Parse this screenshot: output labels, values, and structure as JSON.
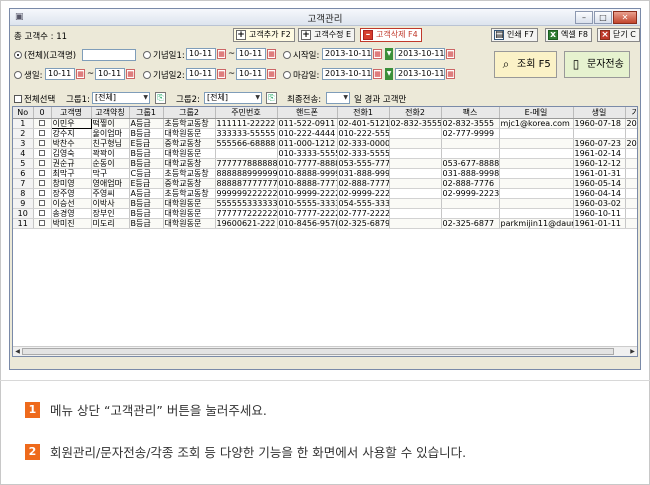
{
  "window": {
    "title": "고객관리"
  },
  "toolbar": {
    "count_label": "총 고객수 : 11",
    "add_label": "고객추가 F2",
    "edit_label": "고객수정 E",
    "delete_label": "고객삭제 F4",
    "print_label": "인쇄 F7",
    "excel_label": "엑셀 F8",
    "close_label": "닫기 C"
  },
  "filters": {
    "all_label": "(전체)",
    "customer_name_label": "(고객명)",
    "birthday_label": "생일:",
    "anniv1_label": "기념일1:",
    "anniv2_label": "기념일2:",
    "start_label": "시작일:",
    "deadline_label": "마감일:",
    "date_short": "10-11",
    "date_full": "2013-10-11",
    "tilde": "~",
    "search_label": "조회 F5",
    "sms_label": "문자전송"
  },
  "row2": {
    "select_all_label": "전체선택",
    "group1_label": "그룹1:",
    "group1_value": "[전체]",
    "group2_label": "그룹2:",
    "group2_value": "[전체]",
    "last_sent_label": "최종전송:",
    "days_suffix": "일 경과 고객만"
  },
  "table": {
    "columns": [
      "No",
      "0",
      "고객명",
      "고객약칭",
      "그룹1",
      "그룹2",
      "주민번호",
      "핸드폰",
      "전화1",
      "전화2",
      "팩스",
      "E-메일",
      "생일",
      "기념"
    ],
    "rows": [
      [
        "1",
        "",
        "이민우",
        "떡찧이",
        "A등급",
        "초등학교동창",
        "111111-22222",
        "011-522-0911",
        "02-401-5121",
        "02-832-3555",
        "02-832-3555",
        "mjc1@korea.com",
        "1960-07-18",
        "2008-"
      ],
      [
        "2",
        "",
        "강수지",
        "울이엄마",
        "B등급",
        "대학원동문",
        "333333-55555",
        "010-222-4444",
        "010-222-5555",
        "",
        "02-777-9999",
        "",
        "",
        ""
      ],
      [
        "3",
        "",
        "박찬수",
        "친구형님",
        "E등급",
        "중학교동창",
        "555566-68888",
        "011-000-1212",
        "02-333-0000",
        "",
        "",
        "",
        "1960-07-23",
        "2008-"
      ],
      [
        "4",
        "",
        "김영숙",
        "꽉꽉이",
        "B등급",
        "대학원동문",
        "",
        "010-3333-5555",
        "02-333-5555",
        "",
        "",
        "",
        "1961-02-14",
        ""
      ],
      [
        "5",
        "",
        "권순규",
        "순동이",
        "B등급",
        "대학교동창",
        "777777888888",
        "010-7777-8888",
        "053-555-7777",
        "",
        "053-677-8888",
        "",
        "1960-12-12",
        ""
      ],
      [
        "6",
        "",
        "최막구",
        "막구",
        "C등급",
        "초등학교동창",
        "888888999999",
        "010-8888-9999",
        "031-888-9999",
        "",
        "031-888-9998",
        "",
        "1961-01-31",
        ""
      ],
      [
        "7",
        "",
        "창미영",
        "영애엄마",
        "E등급",
        "중학교동창",
        "888887777777",
        "010-8888-7777",
        "02-888-7777",
        "",
        "02-888-7776",
        "",
        "1960-05-14",
        ""
      ],
      [
        "8",
        "",
        "장주영",
        "주영씨",
        "A등급",
        "초등학교동창",
        "999999222222",
        "010-9999-2222",
        "02-9999-2222",
        "",
        "02-9999-2223",
        "",
        "1960-04-14",
        ""
      ],
      [
        "9",
        "",
        "이승선",
        "이박사",
        "B등급",
        "대학원동문",
        "555555333333",
        "010-5555-3333",
        "054-555-3333",
        "",
        "",
        "",
        "1960-03-02",
        ""
      ],
      [
        "10",
        "",
        "송경영",
        "장부인",
        "B등급",
        "대학원동문",
        "777777222222",
        "010-7777-2222",
        "02-777-2222",
        "",
        "",
        "",
        "1960-10-11",
        ""
      ],
      [
        "11",
        "",
        "박미진",
        "미도리",
        "B등급",
        "대학원동문",
        "19600621-222",
        "010-8456-9578",
        "02-325-6879",
        "",
        "02-325-6877",
        "parkmijin11@daur",
        "1961-01-11",
        ""
      ]
    ]
  },
  "notes": [
    {
      "num": "1",
      "text": "메뉴 상단 “고객관리” 버튼을 눌러주세요."
    },
    {
      "num": "2",
      "text": "회원관리/문자전송/각종 조회 등 다양한 기능을 한 화면에서 사용할 수 있습니다."
    }
  ],
  "colors": {
    "accent": "#ee6a1c",
    "selected_row": "#dde8d0",
    "row_alt": "#ffffff"
  }
}
